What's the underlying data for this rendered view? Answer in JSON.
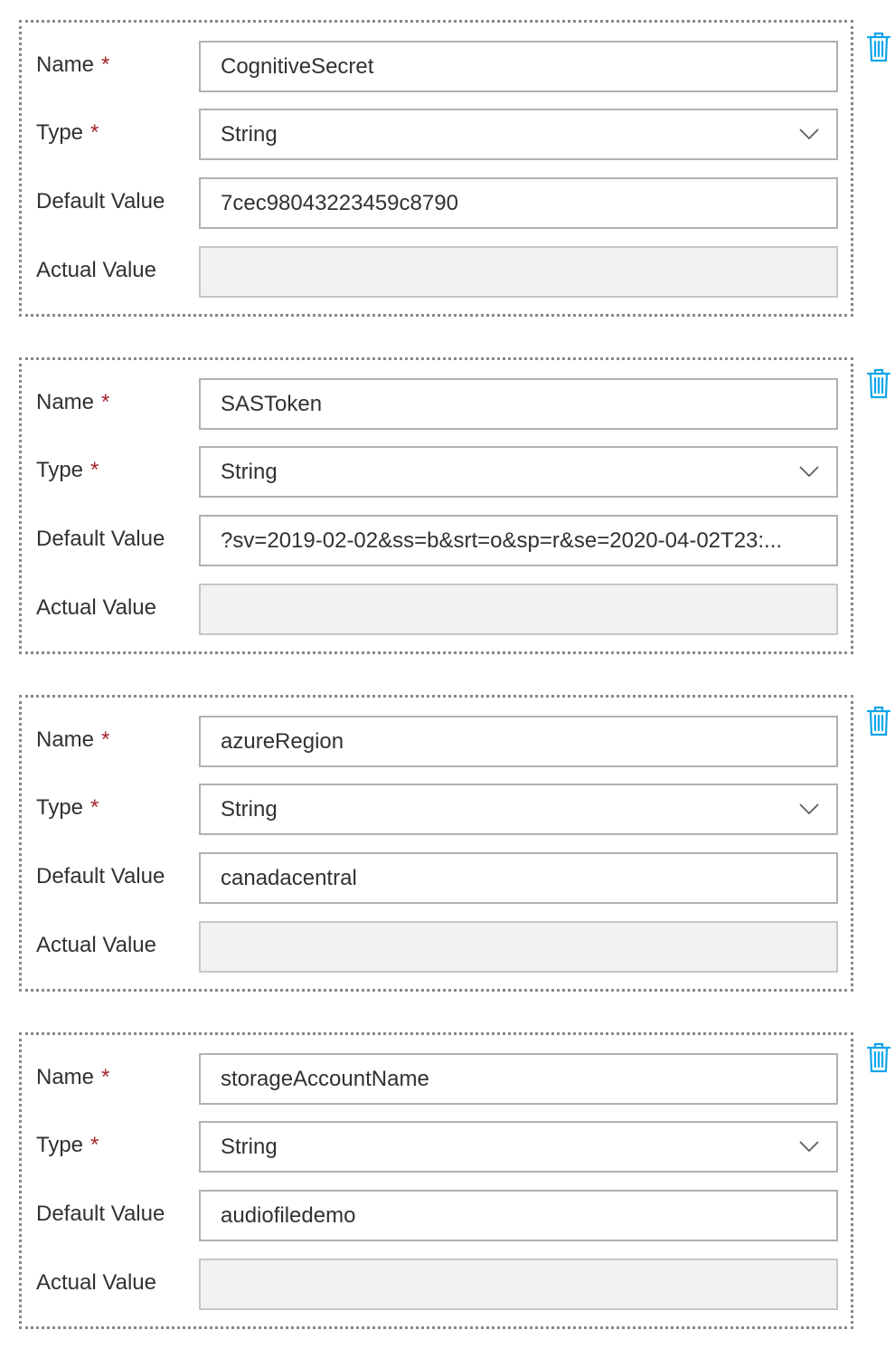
{
  "labels": {
    "name": "Name",
    "type": "Type",
    "default_value": "Default Value",
    "actual_value": "Actual Value",
    "required_marker": "*"
  },
  "colors": {
    "accent": "#0ea5e9",
    "required": "#a4262c",
    "border": "#b3b0ad",
    "disabled_bg": "#f3f2f1"
  },
  "icons": {
    "delete": "trash-icon",
    "dropdown": "chevron-down-icon"
  },
  "parameters": [
    {
      "name": "CognitiveSecret",
      "type": "String",
      "default_value": "7cec98043223459c8790",
      "actual_value": ""
    },
    {
      "name": "SASToken",
      "type": "String",
      "default_value": "?sv=2019-02-02&ss=b&srt=o&sp=r&se=2020-04-02T23:...",
      "actual_value": ""
    },
    {
      "name": "azureRegion",
      "type": "String",
      "default_value": "canadacentral",
      "actual_value": ""
    },
    {
      "name": "storageAccountName",
      "type": "String",
      "default_value": "audiofiledemo",
      "actual_value": ""
    }
  ]
}
